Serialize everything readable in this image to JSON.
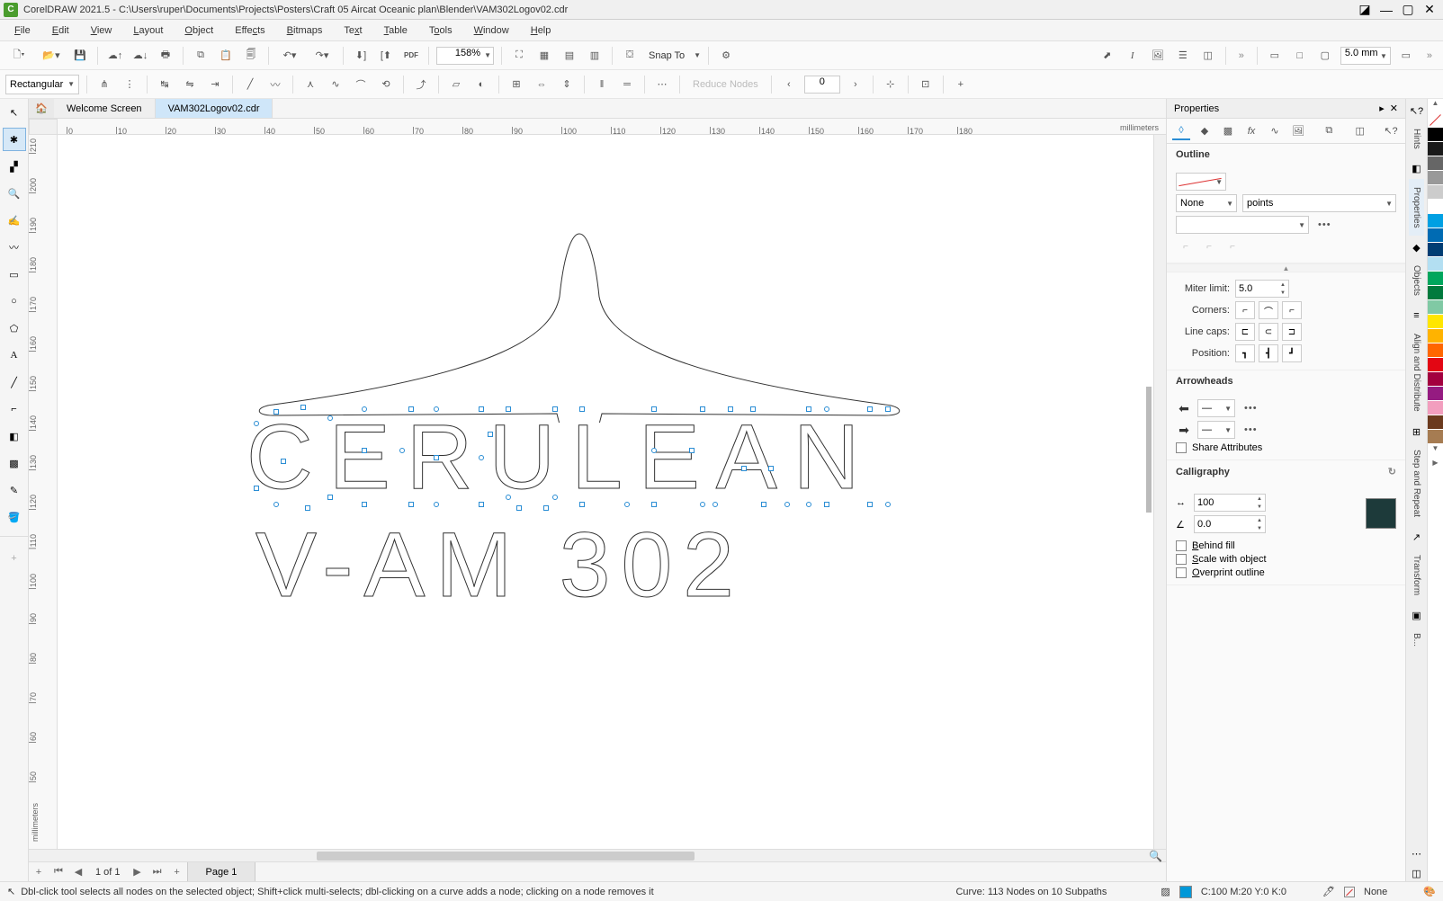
{
  "title": "CorelDRAW 2021.5 - C:\\Users\\ruper\\Documents\\Projects\\Posters\\Craft 05 Aircat Oceanic plan\\Blender\\VAM302Logov02.cdr",
  "menus": [
    "File",
    "Edit",
    "View",
    "Layout",
    "Object",
    "Effects",
    "Bitmaps",
    "Text",
    "Table",
    "Tools",
    "Window",
    "Help"
  ],
  "zoom": "158%",
  "snap_to": "Snap To",
  "outline_width_box": "5.0 mm",
  "propbar": {
    "shape_select": "Rectangular",
    "angle": "0",
    "reduce": "Reduce Nodes"
  },
  "tabs": {
    "welcome": "Welcome Screen",
    "active": "VAM302Logov02.cdr"
  },
  "ruler_h": {
    "ticks": [
      "0",
      "10",
      "20",
      "30",
      "40",
      "50",
      "60",
      "70",
      "80",
      "90",
      "100",
      "110",
      "120",
      "130",
      "140",
      "150",
      "160",
      "170",
      "180"
    ],
    "unit": "millimeters"
  },
  "ruler_v": {
    "ticks": [
      "210",
      "200",
      "190",
      "180",
      "170",
      "160",
      "150",
      "140",
      "130",
      "120",
      "110",
      "100",
      "90",
      "80",
      "70",
      "60",
      "50"
    ],
    "unit": "millimeters"
  },
  "art": {
    "line1": "CERULEAN",
    "line2": "V-AM 302"
  },
  "pagenav": {
    "range": "1 of 1",
    "tab": "Page 1"
  },
  "status": {
    "hint": "Dbl-click tool selects all nodes on the selected object; Shift+click multi-selects; dbl-clicking on a curve adds a node; clicking on a node removes it",
    "curve": "Curve: 113 Nodes on 10 Subpaths",
    "fill": "C:100 M:20 Y:0 K:0",
    "outline": "None"
  },
  "props": {
    "title": "Properties",
    "outline": {
      "heading": "Outline",
      "width_select": "None",
      "unit_select": "points",
      "miter_lbl": "Miter limit:",
      "miter_val": "5.0",
      "corners_lbl": "Corners:",
      "linecaps_lbl": "Line caps:",
      "position_lbl": "Position:",
      "arrow_heading": "Arrowheads",
      "share_attrs": "Share Attributes",
      "calli_heading": "Calligraphy",
      "stretch": "100",
      "angle": "0.0",
      "behind": "Behind fill",
      "scale": "Scale with object",
      "overprint": "Overprint outline"
    }
  },
  "dock_tabs": [
    "Hints",
    "Properties",
    "Objects",
    "Align and Distribute",
    "Step and Repeat",
    "Transform",
    "B..."
  ],
  "colors": [
    "#000000",
    "#1a1a1a",
    "#666666",
    "#999999",
    "#cccccc",
    "#ffffff",
    "#00a0e3",
    "#006bb3",
    "#003d73",
    "#b3dff2",
    "#00a65d",
    "#007a3d",
    "#80c9a4",
    "#ffe600",
    "#ffb300",
    "#ff6600",
    "#e30613",
    "#a3003f",
    "#951b81",
    "#f29ebe",
    "#6b3a1e",
    "#a67c52"
  ]
}
